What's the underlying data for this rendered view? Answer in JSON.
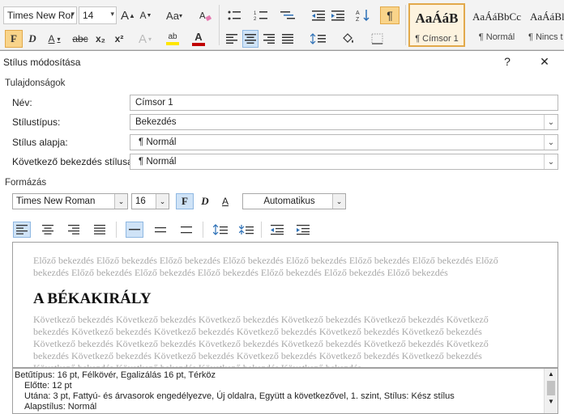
{
  "ribbon": {
    "font_name": "Times New Ror",
    "font_size": "14",
    "grow_font": "A",
    "shrink_font": "A",
    "change_case": "Aa",
    "bold": "F",
    "italic": "D",
    "underline": "A",
    "strikethrough": "abc",
    "subscript": "x₂",
    "superscript": "x²",
    "text_effects": "A",
    "highlight": "ab",
    "font_color": "A",
    "pilcrow": "¶",
    "accent_color": "#c00000",
    "highlight_color": "#ffe600",
    "styles": [
      {
        "sample": "AaÁáB",
        "name": "¶ Címsor 1"
      },
      {
        "sample": "AaÁáBbCc",
        "name": "¶ Normál"
      },
      {
        "sample": "AaÁáBl",
        "name": "¶ Nincs t"
      }
    ]
  },
  "dialog": {
    "title": "Stílus módosítása",
    "help": "?",
    "close": "✕",
    "properties_label": "Tulajdonságok",
    "fields": {
      "name_label": "Név:",
      "name_value": "Címsor 1",
      "type_label": "Stílustípus:",
      "type_value": "Bekezdés",
      "based_label": "Stílus alapja:",
      "based_value": "¶ Normál",
      "next_label": "Következő bekezdés stílusa:",
      "next_value": "¶ Normál"
    },
    "formatting_label": "Formázás",
    "format": {
      "font": "Times New Roman",
      "size": "16",
      "bold": "F",
      "italic": "D",
      "underline": "A",
      "color": "Automatikus"
    },
    "preview": {
      "previous_text": "Előző bekezdés Előző bekezdés Előző bekezdés Előző bekezdés Előző bekezdés Előző bekezdés Előző bekezdés Előző bekezdés Előző bekezdés Előző bekezdés Előző bekezdés Előző bekezdés Előző bekezdés Előző bekezdés",
      "heading": "A BÉKAKIRÁLY",
      "next_text": "Következő bekezdés Következő bekezdés Következő bekezdés Következő bekezdés Következő bekezdés Következő bekezdés Következő bekezdés Következő bekezdés Következő bekezdés Következő bekezdés Következő bekezdés Következő bekezdés Következő bekezdés Következő bekezdés Következő bekezdés Következő bekezdés Következő bekezdés Következő bekezdés Következő bekezdés Következő bekezdés Következő bekezdés Következő bekezdés Következő bekezdés Következő bekezdés Következő bekezdés Következő bekezdés"
    },
    "description": {
      "line1": "Betűtípus: 16 pt, Félkövér, Egalizálás 16 pt, Térköz",
      "line2": "Előtte:  12 pt",
      "line3": "Utána:  3 pt, Fattyú- és árvasorok engedélyezve, Új oldalra, Együtt a következővel, 1. szint, Stílus: Kész stílus",
      "line4": "Alapstílus: Normál"
    }
  }
}
